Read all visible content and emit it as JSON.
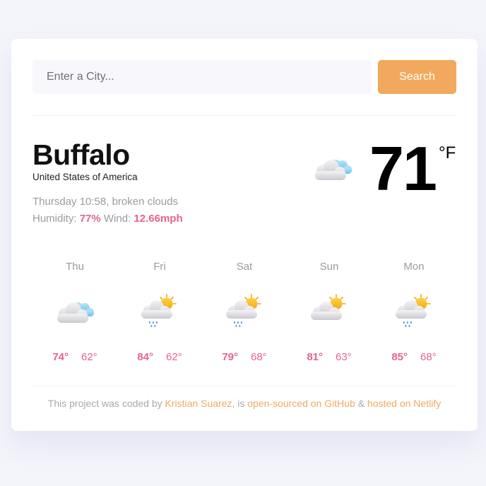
{
  "search": {
    "placeholder": "Enter a City...",
    "value": "",
    "button_label": "Search"
  },
  "current": {
    "city": "Buffalo",
    "country": "United States of America",
    "description": "Thursday 10:58, broken clouds",
    "humidity_label": "Humidity:",
    "humidity": "77%",
    "wind_label": "Wind:",
    "wind": "12.66mph",
    "temperature": "71",
    "unit": "°F",
    "icon": "broken-clouds-icon"
  },
  "forecast": [
    {
      "day": "Thu",
      "high": "74°",
      "low": "62°",
      "icon": "broken-clouds-icon"
    },
    {
      "day": "Fri",
      "high": "84°",
      "low": "62°",
      "icon": "sun-rain-icon"
    },
    {
      "day": "Sat",
      "high": "79°",
      "low": "68°",
      "icon": "sun-rain-icon"
    },
    {
      "day": "Sun",
      "high": "81°",
      "low": "63°",
      "icon": "partly-sunny-icon"
    },
    {
      "day": "Mon",
      "high": "85°",
      "low": "68°",
      "icon": "sun-rain-icon"
    }
  ],
  "footer": {
    "prefix": "This project was coded by",
    "author_link": "Kristian Suarez",
    "middle": ", is",
    "github_link": "open-sourced on GitHub",
    "and": "&",
    "netlify_link": "hosted on Netlify"
  },
  "colors": {
    "accent": "#f2a95e",
    "highlight": "#e8648a",
    "muted": "#9a9aa2",
    "background": "#f4f4fb",
    "card": "#ffffff"
  }
}
